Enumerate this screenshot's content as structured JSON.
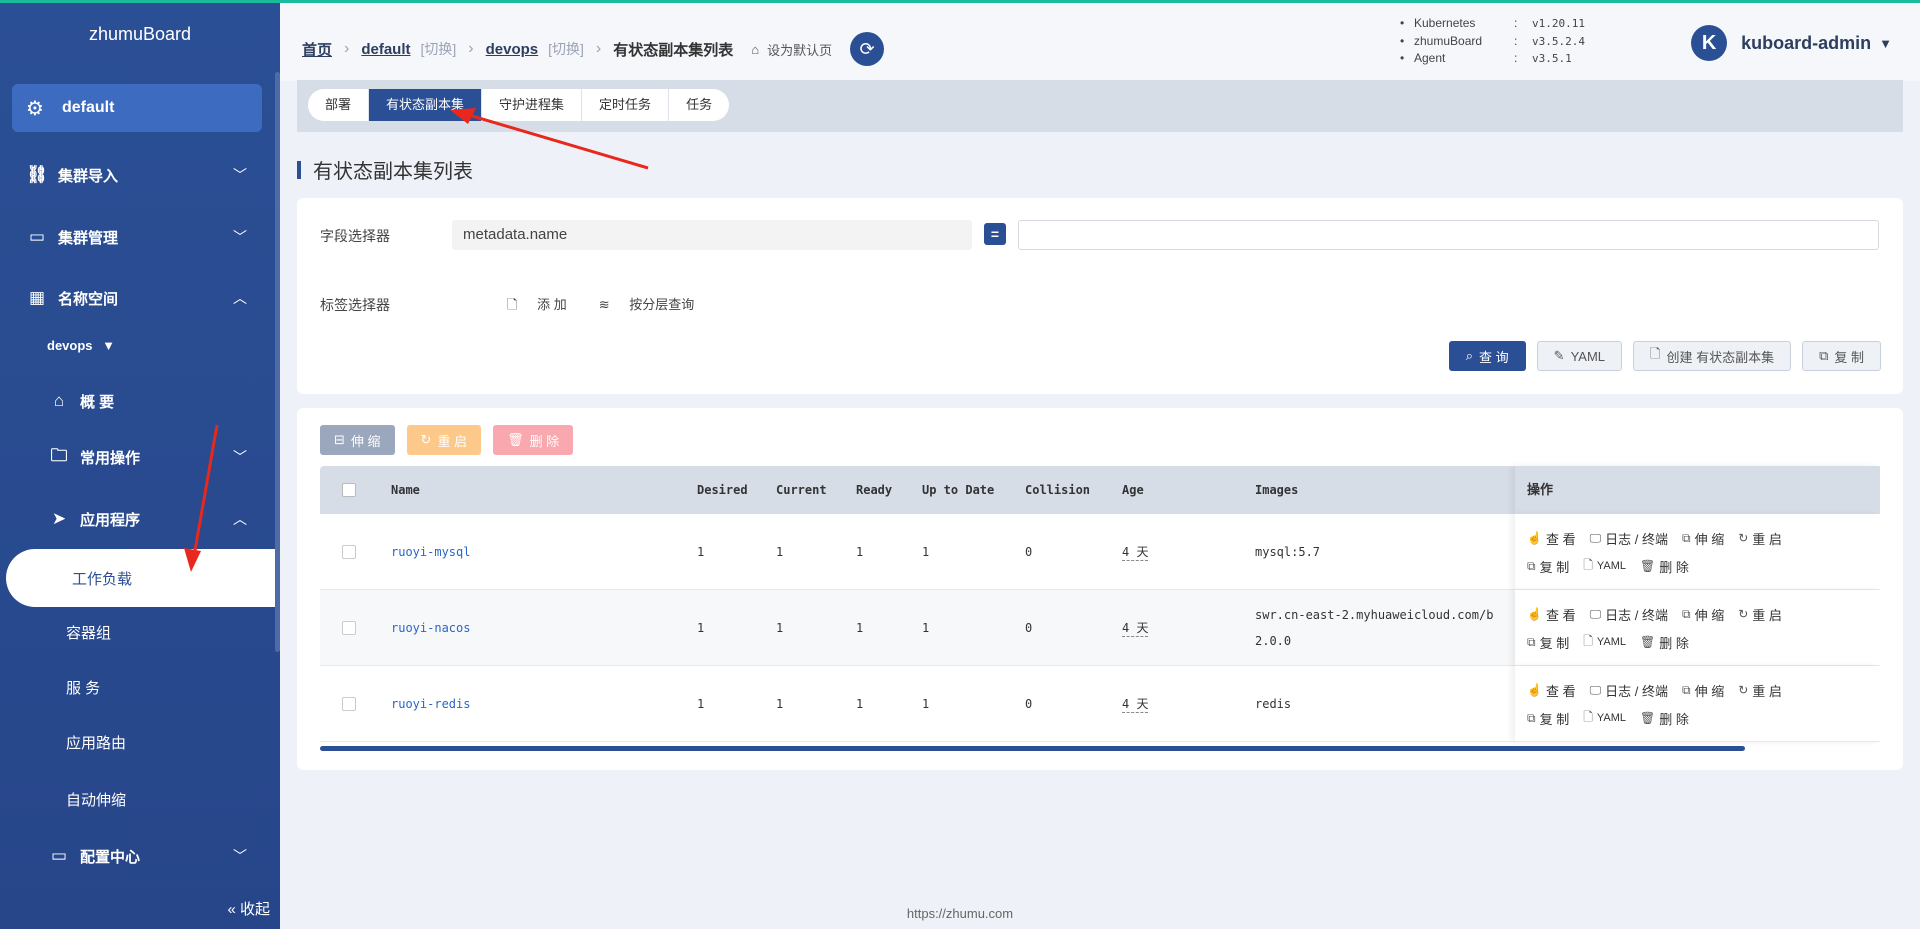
{
  "sidebar": {
    "brand": "zhumuBoard",
    "cluster": "default",
    "items": {
      "cluster_import": "集群导入",
      "cluster_manage": "集群管理",
      "namespace": "名称空间",
      "namespace_value": "devops",
      "overview": "概 要",
      "common_ops": "常用操作",
      "applications": "应用程序",
      "workloads": "工作负载",
      "pods": "容器组",
      "services": "服 务",
      "ingress": "应用路由",
      "autoscale": "自动伸缩",
      "config": "配置中心"
    },
    "collapse": "收起"
  },
  "header": {
    "crumb_home": "首页",
    "crumb_cluster": "default",
    "crumb_ns": "devops",
    "switch_label": "[切换]",
    "crumb_current": "有状态副本集列表",
    "set_default": "设为默认页",
    "versions": [
      {
        "k": "Kubernetes",
        "v": "v1.20.11"
      },
      {
        "k": "zhumuBoard",
        "v": "v3.5.2.4"
      },
      {
        "k": "Agent",
        "v": "v3.5.1"
      }
    ],
    "user_initial": "K",
    "user": "kuboard-admin"
  },
  "tabs": [
    "部署",
    "有状态副本集",
    "守护进程集",
    "定时任务",
    "任务"
  ],
  "page_title": "有状态副本集列表",
  "filter": {
    "field_label": "字段选择器",
    "field_value": "metadata.name",
    "eq": "=",
    "label_label": "标签选择器",
    "add": "添 加",
    "layered": "按分层查询",
    "query": "查 询",
    "yaml": "YAML",
    "create": "创建 有状态副本集",
    "copy": "复 制"
  },
  "bulk": {
    "scale": "伸 缩",
    "restart": "重 启",
    "delete": "删 除"
  },
  "table": {
    "headers": {
      "name": "Name",
      "desired": "Desired",
      "current": "Current",
      "ready": "Ready",
      "uptodate": "Up to Date",
      "collision": "Collision",
      "age": "Age",
      "images": "Images",
      "ops": "操作"
    },
    "rows": [
      {
        "name": "ruoyi-mysql",
        "desired": "1",
        "current": "1",
        "ready": "1",
        "uptodate": "1",
        "collision": "0",
        "age": "4 天",
        "image1": "mysql:5.7",
        "image2": ""
      },
      {
        "name": "ruoyi-nacos",
        "desired": "1",
        "current": "1",
        "ready": "1",
        "uptodate": "1",
        "collision": "0",
        "age": "4 天",
        "image1": "swr.cn-east-2.myhuaweicloud.com/b",
        "image2": "2.0.0"
      },
      {
        "name": "ruoyi-redis",
        "desired": "1",
        "current": "1",
        "ready": "1",
        "uptodate": "1",
        "collision": "0",
        "age": "4 天",
        "image1": "redis",
        "image2": ""
      }
    ],
    "ops": {
      "view": "查 看",
      "logs": "日志 / 终端",
      "scale": "伸 缩",
      "restart": "重 启",
      "copy": "复 制",
      "yaml": "YAML",
      "delete": "删 除"
    }
  },
  "footer": "https://zhumu.com"
}
